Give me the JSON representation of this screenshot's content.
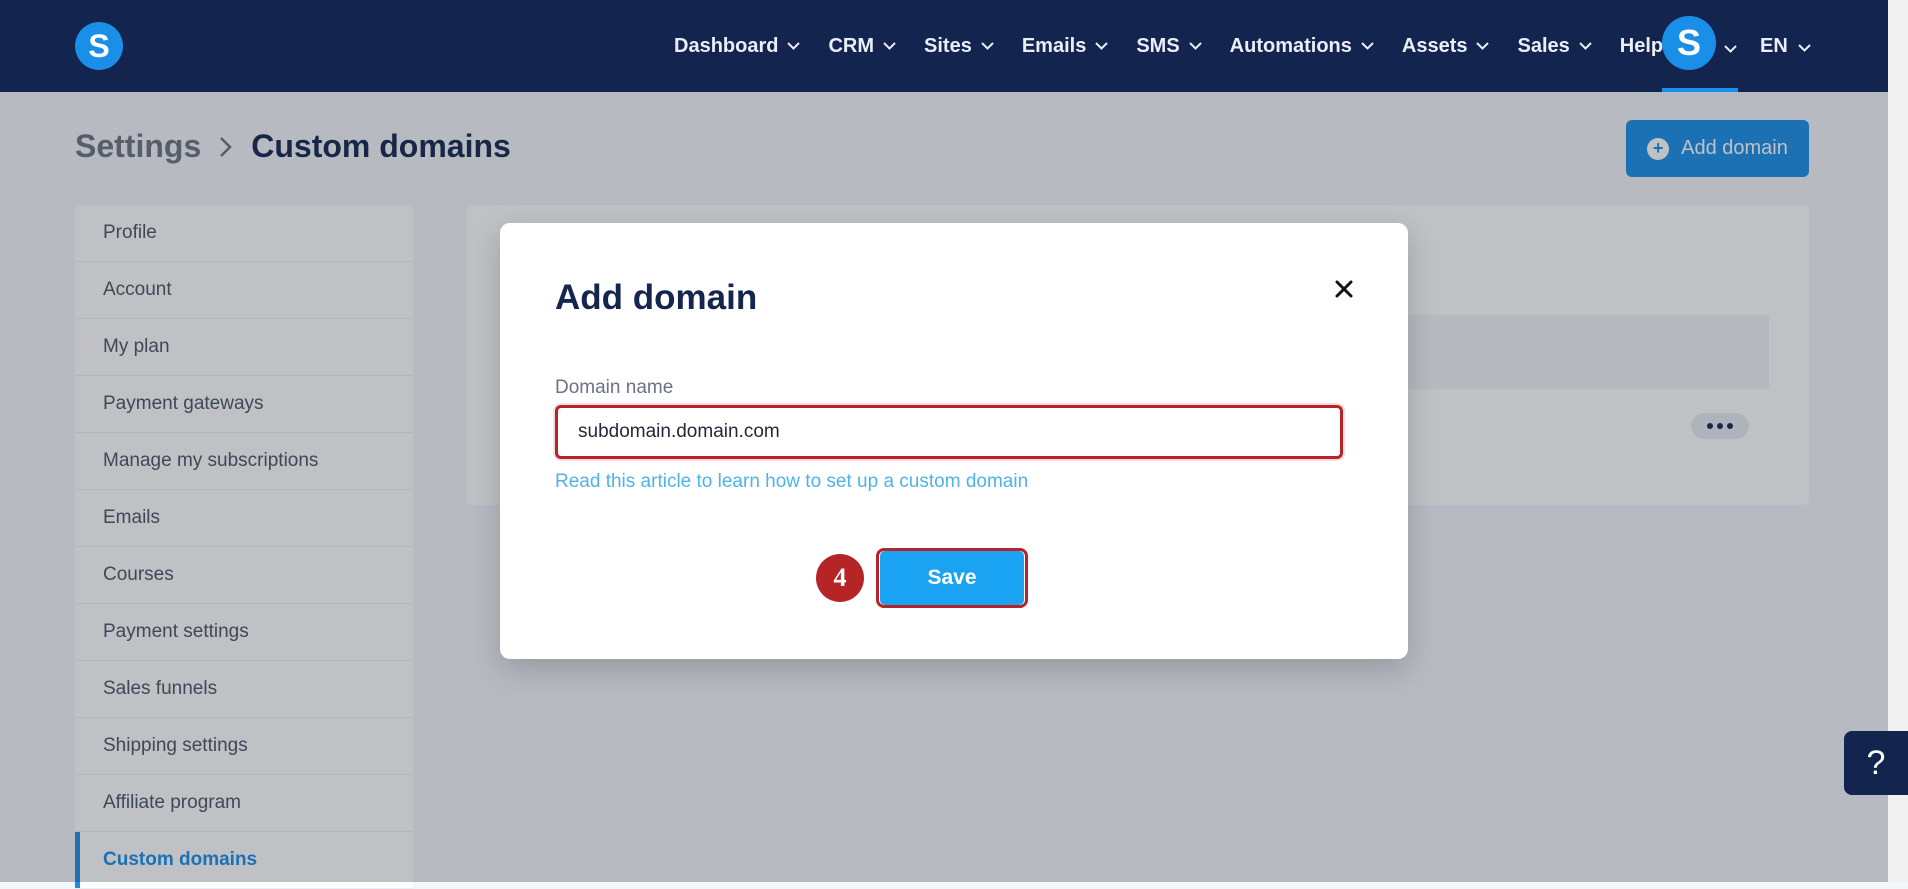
{
  "app": {
    "logo_letter": "S",
    "accent_color": "#1a8fe8",
    "nav_bg": "#13254f"
  },
  "nav": {
    "items": [
      {
        "label": "Dashboard",
        "has_dropdown": true
      },
      {
        "label": "CRM",
        "has_dropdown": true
      },
      {
        "label": "Sites",
        "has_dropdown": true
      },
      {
        "label": "Emails",
        "has_dropdown": true
      },
      {
        "label": "SMS",
        "has_dropdown": true
      },
      {
        "label": "Automations",
        "has_dropdown": true
      },
      {
        "label": "Assets",
        "has_dropdown": true
      },
      {
        "label": "Sales",
        "has_dropdown": true
      },
      {
        "label": "Help",
        "has_dropdown": false
      }
    ],
    "notification_icon": "bell-icon",
    "avatar_letter": "S",
    "language": "EN"
  },
  "breadcrumb": {
    "root": "Settings",
    "current": "Custom domains"
  },
  "header_actions": {
    "add_domain_label": "Add domain"
  },
  "sidebar": {
    "items": [
      {
        "label": "Profile",
        "active": false
      },
      {
        "label": "Account",
        "active": false
      },
      {
        "label": "My plan",
        "active": false
      },
      {
        "label": "Payment gateways",
        "active": false
      },
      {
        "label": "Manage my subscriptions",
        "active": false
      },
      {
        "label": "Emails",
        "active": false
      },
      {
        "label": "Courses",
        "active": false
      },
      {
        "label": "Payment settings",
        "active": false
      },
      {
        "label": "Sales funnels",
        "active": false
      },
      {
        "label": "Shipping settings",
        "active": false
      },
      {
        "label": "Affiliate program",
        "active": false
      },
      {
        "label": "Custom domains",
        "active": true
      }
    ]
  },
  "modal": {
    "title": "Add domain",
    "field_label": "Domain name",
    "field_value": "subdomain.domain.com",
    "help_link": "Read this article to learn how to set up a custom domain",
    "save_label": "Save",
    "step_number": "4",
    "highlight_color": "#b52426"
  },
  "help_fab": {
    "label": "?"
  }
}
